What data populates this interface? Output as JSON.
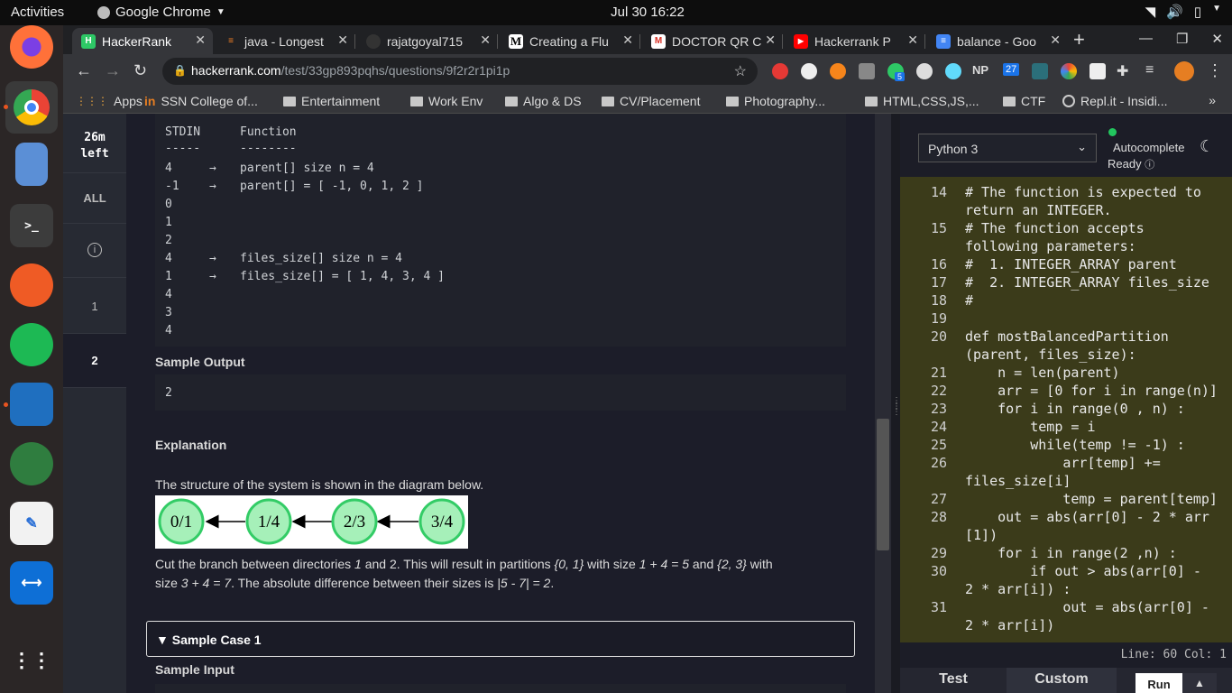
{
  "system": {
    "activities": "Activities",
    "app_name": "Google Chrome",
    "clock": "Jul 30  16:22"
  },
  "tabs": [
    {
      "label": "HackerRank",
      "active": true
    },
    {
      "label": "java - Longest"
    },
    {
      "label": "rajatgoyal715"
    },
    {
      "label": "Creating a Flu"
    },
    {
      "label": "DOCTOR QR C"
    },
    {
      "label": "Hackerrank P"
    },
    {
      "label": "balance - Goo"
    }
  ],
  "address": {
    "host": "hackerrank.com",
    "path": "/test/33gp893pqhs/questions/9f2r2r1pi1p"
  },
  "bookmarks": [
    "Apps",
    "SSN College of...",
    "Entertainment",
    "Work Env",
    "Algo & DS",
    "CV/Placement",
    "Photography...",
    "HTML,CSS,JS,...",
    "CTF",
    "Repl.it - Insidi..."
  ],
  "extension_badges": {
    "green": "5",
    "blue": "27",
    "np": "NP"
  },
  "left_nav": {
    "timer_value": "26m",
    "timer_unit": "left",
    "all": "ALL",
    "info": "i",
    "q1": "1",
    "q2": "2"
  },
  "sample_input_block": {
    "header_left": "STDIN",
    "header_right": "Function",
    "dash_left": "-----",
    "dash_right": "--------",
    "rows": [
      {
        "left": "4",
        "arrow": "→",
        "right": "parent[] size n = 4"
      },
      {
        "left": "-1",
        "arrow": "→",
        "right": "parent[] = [ -1, 0, 1, 2 ]"
      },
      {
        "left": "0",
        "arrow": "",
        "right": ""
      },
      {
        "left": "1",
        "arrow": "",
        "right": ""
      },
      {
        "left": "2",
        "arrow": "",
        "right": ""
      },
      {
        "left": "4",
        "arrow": "→",
        "right": "files_size[] size n = 4"
      },
      {
        "left": "1",
        "arrow": "→",
        "right": "files_size[] = [ 1, 4, 3, 4 ]"
      },
      {
        "left": "4",
        "arrow": "",
        "right": ""
      },
      {
        "left": "3",
        "arrow": "",
        "right": ""
      },
      {
        "left": "4",
        "arrow": "",
        "right": ""
      }
    ]
  },
  "sample_output": {
    "heading": "Sample Output",
    "value": "2"
  },
  "explanation": {
    "heading": "Explanation",
    "intro": "The structure of the system is shown in the diagram below.",
    "nodes": [
      "0/1",
      "1/4",
      "2/3",
      "3/4"
    ],
    "line1_a": "Cut the branch between directories ",
    "line1_b": "1",
    "line1_c": " and 2. This will result in partitions ",
    "line1_d": "{0, 1}",
    "line1_e": " with size ",
    "line1_f": "1 + 4 = 5",
    "line1_g": " and ",
    "line1_h": "{2, 3}",
    "line1_i": " with",
    "line2_a": "size ",
    "line2_b": "3 + 4 = 7",
    "line2_c": ". The absolute difference between their sizes is ",
    "line2_d": "|5 - 7| = 2",
    "line2_e": "."
  },
  "sample_case": "Sample Case 1",
  "sample_input_heading": "Sample Input",
  "editor": {
    "language": "Python 3",
    "autocomplete": "Autocomplete",
    "ready": "Ready",
    "status": "Line: 60 Col: 1",
    "test_tab": "Test",
    "custom_tab": "Custom",
    "run": "Run",
    "lines": [
      {
        "n": "14",
        "t": "# The function is expected to",
        "c": "cm"
      },
      {
        "n": "",
        "t": "return an INTEGER.",
        "c": "cm"
      },
      {
        "n": "15",
        "t": "# The function accepts",
        "c": "cm"
      },
      {
        "n": "",
        "t": "following parameters:",
        "c": "cm"
      },
      {
        "n": "16",
        "t": "#  1. INTEGER_ARRAY parent",
        "c": "cm"
      },
      {
        "n": "17",
        "t": "#  2. INTEGER_ARRAY files_size",
        "c": "cm"
      },
      {
        "n": "18",
        "t": "#",
        "c": "cm"
      },
      {
        "n": "19",
        "t": "",
        "c": ""
      },
      {
        "n": "20",
        "t": "def mostBalancedPartition",
        "c": ""
      },
      {
        "n": "",
        "t": "(parent, files_size):",
        "c": ""
      },
      {
        "n": "21",
        "t": "    n = len(parent)",
        "c": ""
      },
      {
        "n": "22",
        "t": "    arr = [0 for i in range(n)]",
        "c": ""
      },
      {
        "n": "23",
        "t": "    for i in range(0 , n) :",
        "c": ""
      },
      {
        "n": "24",
        "t": "        temp = i",
        "c": ""
      },
      {
        "n": "25",
        "t": "        while(temp != -1) :",
        "c": ""
      },
      {
        "n": "26",
        "t": "            arr[temp] +=",
        "c": ""
      },
      {
        "n": "",
        "t": "files_size[i]",
        "c": ""
      },
      {
        "n": "27",
        "t": "            temp = parent[temp]",
        "c": ""
      },
      {
        "n": "28",
        "t": "    out = abs(arr[0] - 2 * arr",
        "c": ""
      },
      {
        "n": "",
        "t": "[1])",
        "c": ""
      },
      {
        "n": "29",
        "t": "    for i in range(2 ,n) :",
        "c": ""
      },
      {
        "n": "30",
        "t": "        if out > abs(arr[0] -",
        "c": ""
      },
      {
        "n": "",
        "t": "2 * arr[i]) :",
        "c": ""
      },
      {
        "n": "31",
        "t": "            out = abs(arr[0] -",
        "c": ""
      },
      {
        "n": "",
        "t": "2 * arr[i])",
        "c": ""
      }
    ]
  }
}
